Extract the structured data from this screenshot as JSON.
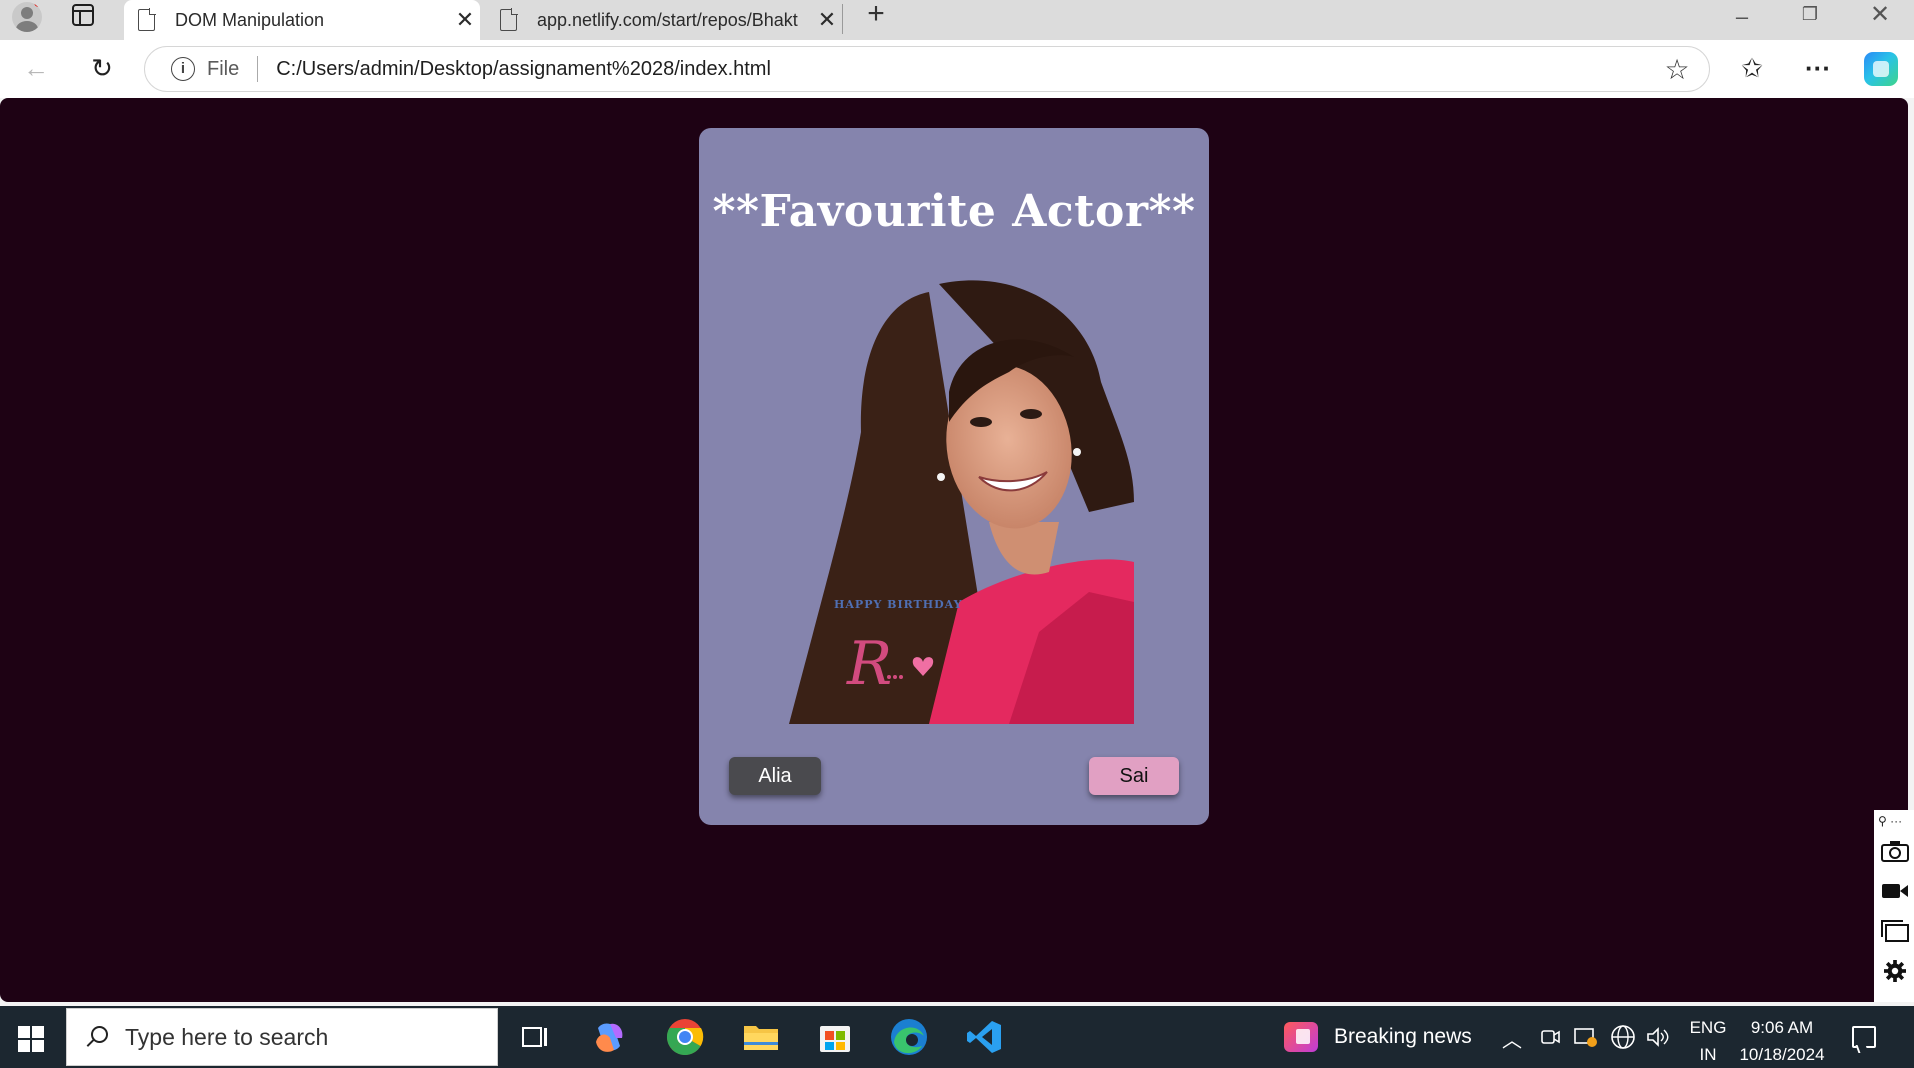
{
  "browser": {
    "tabs": [
      {
        "title": "DOM Manipulation",
        "active": true
      },
      {
        "title": "app.netlify.com/start/repos/Bhakt",
        "active": false
      }
    ],
    "close_glyph": "✕",
    "new_tab_glyph": "+",
    "address_bar": {
      "scheme_label": "File",
      "url": "C:/Users/admin/Desktop/assignament%2028/index.html"
    },
    "window_controls": {
      "minimize": "–",
      "maximize": "❐",
      "close": "✕"
    }
  },
  "page": {
    "background_color": "#1e0214",
    "card_color": "#8584ad",
    "heading": "**Favourite Actor**",
    "photo_caption": "HAPPY BIRTHDAY",
    "photo_signature": "R",
    "buttons": [
      {
        "label": "Alia",
        "color": "#4a4a4e"
      },
      {
        "label": "Sai",
        "color": "#e1a0c3"
      }
    ]
  },
  "taskbar": {
    "search_placeholder": "Type here to search",
    "news_label": "Breaking news",
    "language": {
      "line1": "ENG",
      "line2": "IN"
    },
    "clock": {
      "time": "9:06 AM",
      "date": "10/18/2024"
    },
    "pinned_apps": [
      "task-view",
      "copilot",
      "chrome",
      "file-explorer",
      "microsoft-store",
      "edge",
      "vscode"
    ]
  }
}
